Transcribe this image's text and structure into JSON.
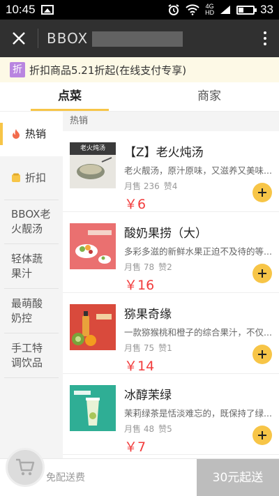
{
  "status": {
    "time": "10:45",
    "signal_top": "4G",
    "signal_bottom": "HD",
    "battery_level": 0.33,
    "battery_text": "33"
  },
  "titlebar": {
    "title": "BBOX"
  },
  "promo": {
    "badge": "折",
    "text": "折扣商品5.21折起(在线支付专享)"
  },
  "tabs": [
    {
      "label": "点菜",
      "active": true
    },
    {
      "label": "商家",
      "active": false
    }
  ],
  "sidebar": {
    "items": [
      {
        "label": "热销"
      },
      {
        "label": "折扣"
      },
      {
        "label": "BBOX老火靓汤"
      },
      {
        "label": "轻体蔬果汁"
      },
      {
        "label": "最萌酸奶控"
      },
      {
        "label": "手工特调饮品"
      }
    ]
  },
  "main": {
    "section": "热销",
    "products": [
      {
        "name": "【Z】老火炖汤",
        "desc": "老火靓汤，原汁原味，又滋养又美味...",
        "sales": "月售 236",
        "likes": "赞4",
        "price": "￥6",
        "thumb_text": "老火炖汤",
        "thumb_color": "#3a3a3a"
      },
      {
        "name": "酸奶果捞（大）",
        "desc": "多彩多滋的新鲜水果正迫不及待的等...",
        "sales": "月售 78",
        "likes": "赞2",
        "price": "￥16",
        "thumb_text": "",
        "thumb_color": "#e36a6a"
      },
      {
        "name": "猕果奇缘",
        "desc": "一款猕猴桃和橙子的综合果汁，不仅...",
        "sales": "月售 75",
        "likes": "赞1",
        "price": "￥14",
        "thumb_text": "",
        "thumb_color": "#d94a3c"
      },
      {
        "name": "冰醇茉绿",
        "desc": "茉莉绿茶是恬淡难忘的，既保持了绿...",
        "sales": "月售 48",
        "likes": "赞5",
        "price": "￥7",
        "thumb_text": "",
        "thumb_color": "#2fae95"
      }
    ]
  },
  "bottom": {
    "free_delivery": "免配送费",
    "checkout": "30元起送"
  },
  "colors": {
    "accent": "#f7c547",
    "price": "#f23c3c",
    "titlebar": "#303030"
  }
}
